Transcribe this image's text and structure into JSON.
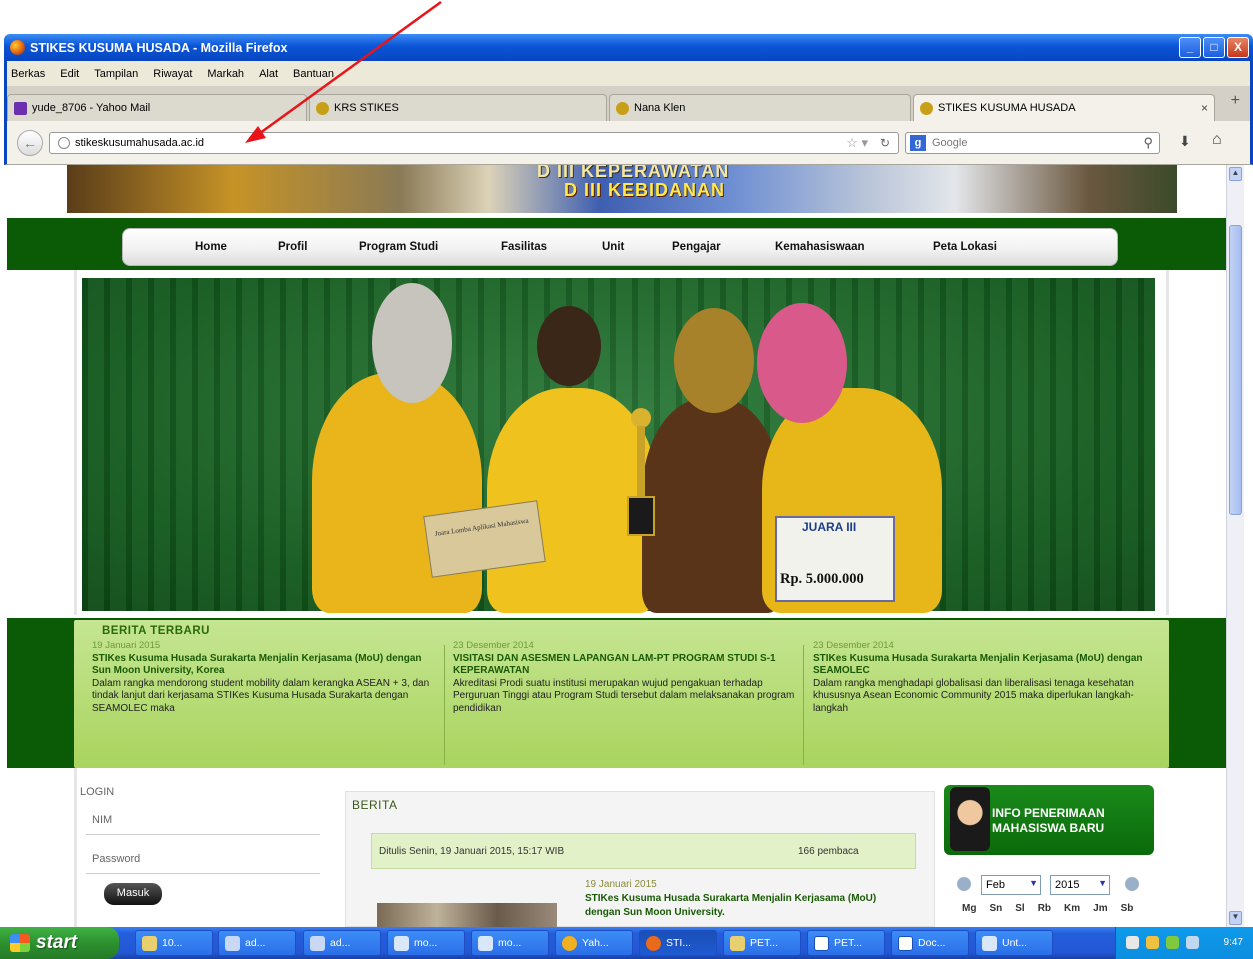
{
  "window": {
    "title": "STIKES KUSUMA HUSADA - Mozilla Firefox",
    "controls": [
      "_",
      "□",
      "X"
    ]
  },
  "menu": {
    "items": [
      "Berkas",
      "Edit",
      "Tampilan",
      "Riwayat",
      "Markah",
      "Alat",
      "Bantuan"
    ]
  },
  "tabs": [
    {
      "label": "yude_8706 - Yahoo Mail",
      "close": ""
    },
    {
      "label": "KRS STIKES",
      "close": ""
    },
    {
      "label": "Nana Klen",
      "close": ""
    },
    {
      "label": "STIKES KUSUMA HUSADA",
      "close": "×"
    }
  ],
  "nav": {
    "url": "stikeskusumahusada.ac.id",
    "search_placeholder": "Google",
    "search_engine_icon": "g"
  },
  "site": {
    "banner_line1": "D III KEPERAWATAN",
    "banner_line2": "D III KEBIDANAN",
    "nav_items": [
      "Home",
      "Profil",
      "Program Studi",
      "Fasilitas",
      "Unit",
      "Pengajar",
      "Kemahasiswaan",
      "Peta Lokasi"
    ],
    "slide": {
      "cert_text": "Juara Lomba Aplikasi Mahasiswa",
      "prize_title": "JUARA III",
      "prize_amount": "Rp. 5.000.000"
    },
    "news_heading": "BERITA TERBARU",
    "news": [
      {
        "date": "19 Januari 2015",
        "title": "STIKes Kusuma Husada Surakarta Menjalin Kerjasama (MoU) dengan Sun Moon University, Korea",
        "body": "Dalam rangka mendorong student mobility dalam kerangka ASEAN + 3, dan tindak lanjut dari kerjasama STIKes Kusuma Husada Surakarta dengan SEAMOLEC maka"
      },
      {
        "date": "23 Desember 2014",
        "title": "VISITASI DAN ASESMEN LAPANGAN LAM-PT PROGRAM STUDI S-1 KEPERAWATAN",
        "body": "Akreditasi Prodi suatu institusi merupakan wujud pengakuan terhadap Perguruan Tinggi atau Program Studi tersebut dalam melaksanakan program pendidikan"
      },
      {
        "date": "23 Desember 2014",
        "title": "STIKes Kusuma Husada Surakarta Menjalin Kerjasama (MoU) dengan SEAMOLEC",
        "body": "Dalam rangka menghadapi globalisasi dan liberalisasi tenaga kesehatan khususnya Asean Economic Community 2015 maka diperlukan langkah-langkah"
      }
    ],
    "login": {
      "heading": "LOGIN",
      "nim_placeholder": "NIM",
      "password_placeholder": "Password",
      "submit": "Masuk"
    },
    "berita": {
      "heading": "BERITA",
      "posted": "Ditulis Senin, 19 Januari 2015, 15:17 WIB",
      "views": "166 pembaca",
      "item_date": "19 Januari 2015",
      "item_title": "STIKes Kusuma Husada Surakarta Menjalin Kerjasama (MoU) dengan Sun Moon University."
    },
    "info_box": {
      "line1": "INFO PENERIMAAN",
      "line2": "MAHASISWA BARU"
    },
    "calendar": {
      "month": "Feb",
      "year": "2015",
      "days": [
        "Mg",
        "Sn",
        "Sl",
        "Rb",
        "Km",
        "Jm",
        "Sb"
      ]
    }
  },
  "taskbar": {
    "start": "start",
    "buttons": [
      "10...",
      "ad...",
      "ad...",
      "mo...",
      "mo...",
      "Yah...",
      "STI...",
      "PET...",
      "PET...",
      "Doc...",
      "Unt..."
    ],
    "clock": "9:47"
  },
  "colors": {
    "site_green": "#0a5a06",
    "news_green": "#a9d45e",
    "xp_blue": "#245edb",
    "start_green": "#2d912f",
    "annotation_arrow": "#e8141a"
  }
}
